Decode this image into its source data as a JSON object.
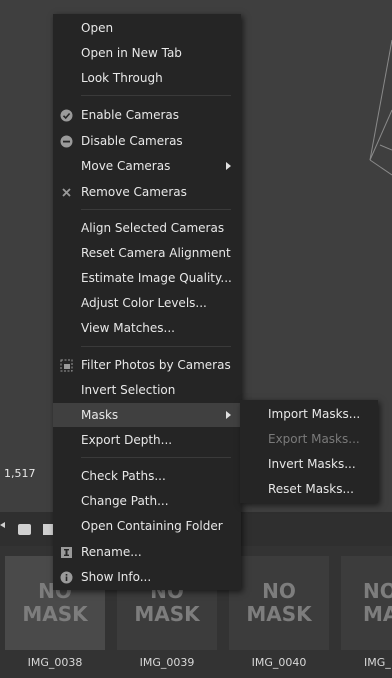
{
  "viewport": {
    "coordinate_readout": "1,517"
  },
  "context_menu": {
    "items": [
      {
        "label": "Open",
        "icon": ""
      },
      {
        "label": "Open in New Tab",
        "icon": ""
      },
      {
        "label": "Look Through",
        "icon": ""
      },
      {
        "label": "Enable Cameras",
        "icon": "check-circle-icon"
      },
      {
        "label": "Disable Cameras",
        "icon": "minus-circle-icon"
      },
      {
        "label": "Move Cameras",
        "icon": "",
        "submenu": true
      },
      {
        "label": "Remove Cameras",
        "icon": "x-icon"
      },
      {
        "label": "Align Selected Cameras",
        "icon": ""
      },
      {
        "label": "Reset Camera Alignment",
        "icon": ""
      },
      {
        "label": "Estimate Image Quality...",
        "icon": ""
      },
      {
        "label": "Adjust Color Levels...",
        "icon": ""
      },
      {
        "label": "View Matches...",
        "icon": ""
      },
      {
        "label": "Filter Photos by Cameras",
        "icon": "filter-photos-icon"
      },
      {
        "label": "Invert Selection",
        "icon": ""
      },
      {
        "label": "Masks",
        "icon": "",
        "submenu": true,
        "highlighted": true
      },
      {
        "label": "Export Depth...",
        "icon": ""
      },
      {
        "label": "Check Paths...",
        "icon": ""
      },
      {
        "label": "Change Path...",
        "icon": ""
      },
      {
        "label": "Open Containing Folder",
        "icon": ""
      },
      {
        "label": "Rename...",
        "icon": "rename-icon"
      },
      {
        "label": "Show Info...",
        "icon": "info-icon"
      }
    ]
  },
  "masks_submenu": {
    "items": [
      {
        "label": "Import Masks...",
        "enabled": true
      },
      {
        "label": "Export Masks...",
        "enabled": false
      },
      {
        "label": "Invert Masks...",
        "enabled": true
      },
      {
        "label": "Reset Masks...",
        "enabled": true
      }
    ]
  },
  "thumbnails": [
    {
      "line1": "NO",
      "line2": "MASK",
      "caption": "IMG_0038"
    },
    {
      "line1": "NO",
      "line2": "MASK",
      "caption": "IMG_0039"
    },
    {
      "line1": "NO",
      "line2": "MASK",
      "caption": "IMG_0040"
    },
    {
      "line1": "NO",
      "line2": "MA",
      "caption": "IMG_"
    }
  ],
  "colors": {
    "menu_bg": "#252525",
    "highlight": "#404040",
    "viewport_bg": "#3f3f3f"
  }
}
